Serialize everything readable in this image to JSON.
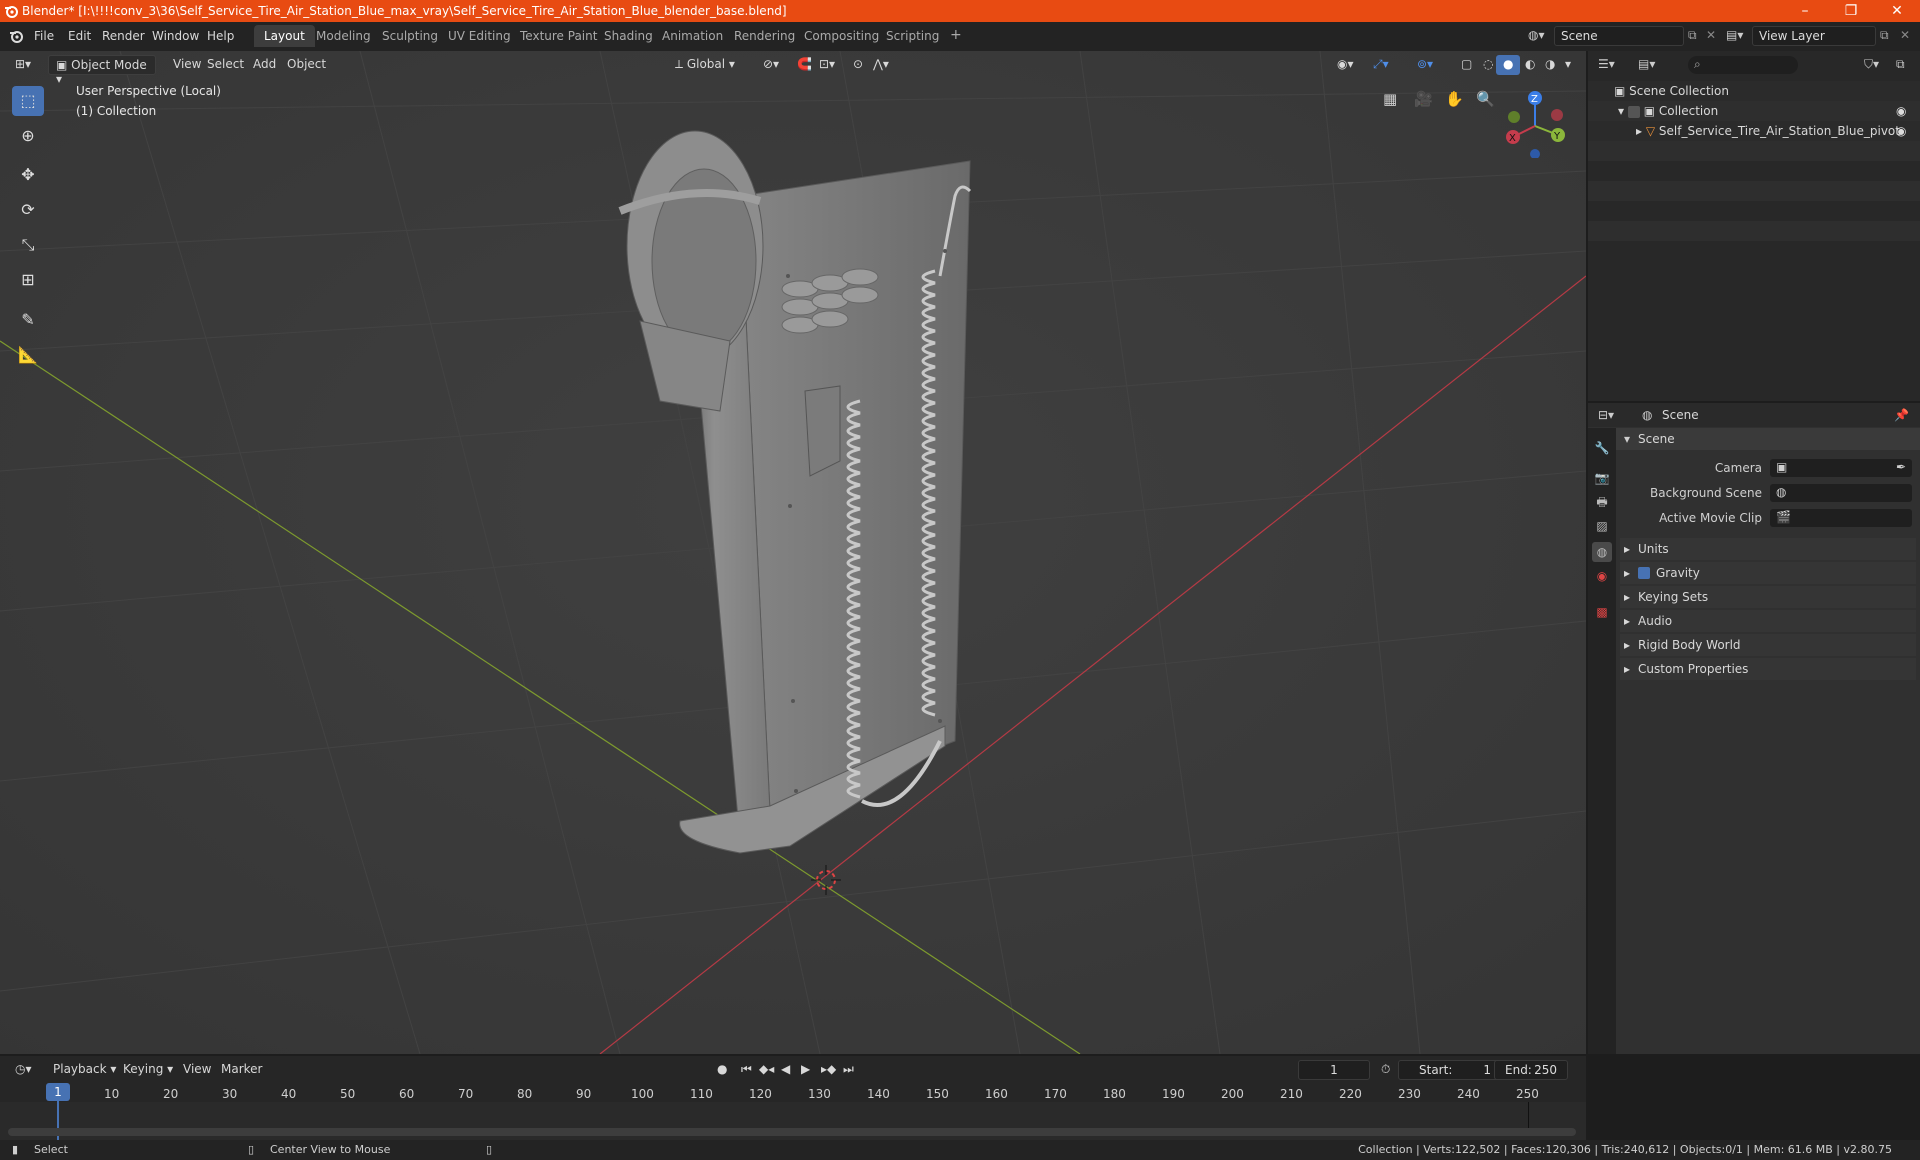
{
  "title": "Blender* [I:\\!!!!conv_3\\36\\Self_Service_Tire_Air_Station_Blue_max_vray\\Self_Service_Tire_Air_Station_Blue_blender_base.blend]",
  "menu": [
    "File",
    "Edit",
    "Render",
    "Window",
    "Help"
  ],
  "workspaces": [
    "Layout",
    "Modeling",
    "Sculpting",
    "UV Editing",
    "Texture Paint",
    "Shading",
    "Animation",
    "Rendering",
    "Compositing",
    "Scripting"
  ],
  "add_workspace": "+",
  "scene_field": "Scene",
  "view_layer_field": "View Layer",
  "viewport_header": {
    "mode": "Object Mode",
    "view": "View",
    "select": "Select",
    "add": "Add",
    "object": "Object",
    "transform": "Global"
  },
  "viewport_overlay": {
    "perspective": "User Perspective (Local)",
    "collection": "(1) Collection"
  },
  "gizmo": {
    "x": "X",
    "y": "Y",
    "z": "Z"
  },
  "outliner": {
    "scene_collection": "Scene Collection",
    "collection": "Collection",
    "object": "Self_Service_Tire_Air_Station_Blue_pivot"
  },
  "properties": {
    "context": "Scene",
    "panel": "Scene",
    "camera_label": "Camera",
    "background_scene_label": "Background Scene",
    "active_movie_clip_label": "Active Movie Clip",
    "subpanels": [
      "Units",
      "Gravity",
      "Keying Sets",
      "Audio",
      "Rigid Body World",
      "Custom Properties"
    ]
  },
  "timeline": {
    "playback": "Playback",
    "keying": "Keying",
    "view": "View",
    "marker": "Marker",
    "current_frame": "1",
    "start_label": "Start:",
    "start": "1",
    "end_label": "End:",
    "end": "250",
    "ticks": [
      "10",
      "20",
      "30",
      "40",
      "50",
      "60",
      "70",
      "80",
      "90",
      "100",
      "110",
      "120",
      "130",
      "140",
      "150",
      "160",
      "170",
      "180",
      "190",
      "200",
      "210",
      "220",
      "230",
      "240",
      "250"
    ],
    "current_marker": "1"
  },
  "status": {
    "select": "Select",
    "center_view": "Center View to Mouse",
    "stats": "Collection | Verts:122,502 | Faces:120,306 | Tris:240,612 | Objects:0/1 | Mem: 61.6 MB | v2.80.75"
  },
  "colors": {
    "accent": "#4772b3",
    "titlebar": "#e84b12",
    "x_axis": "#c43c4c",
    "y_axis": "#8bb63b",
    "z_axis": "#3b7ee8"
  }
}
